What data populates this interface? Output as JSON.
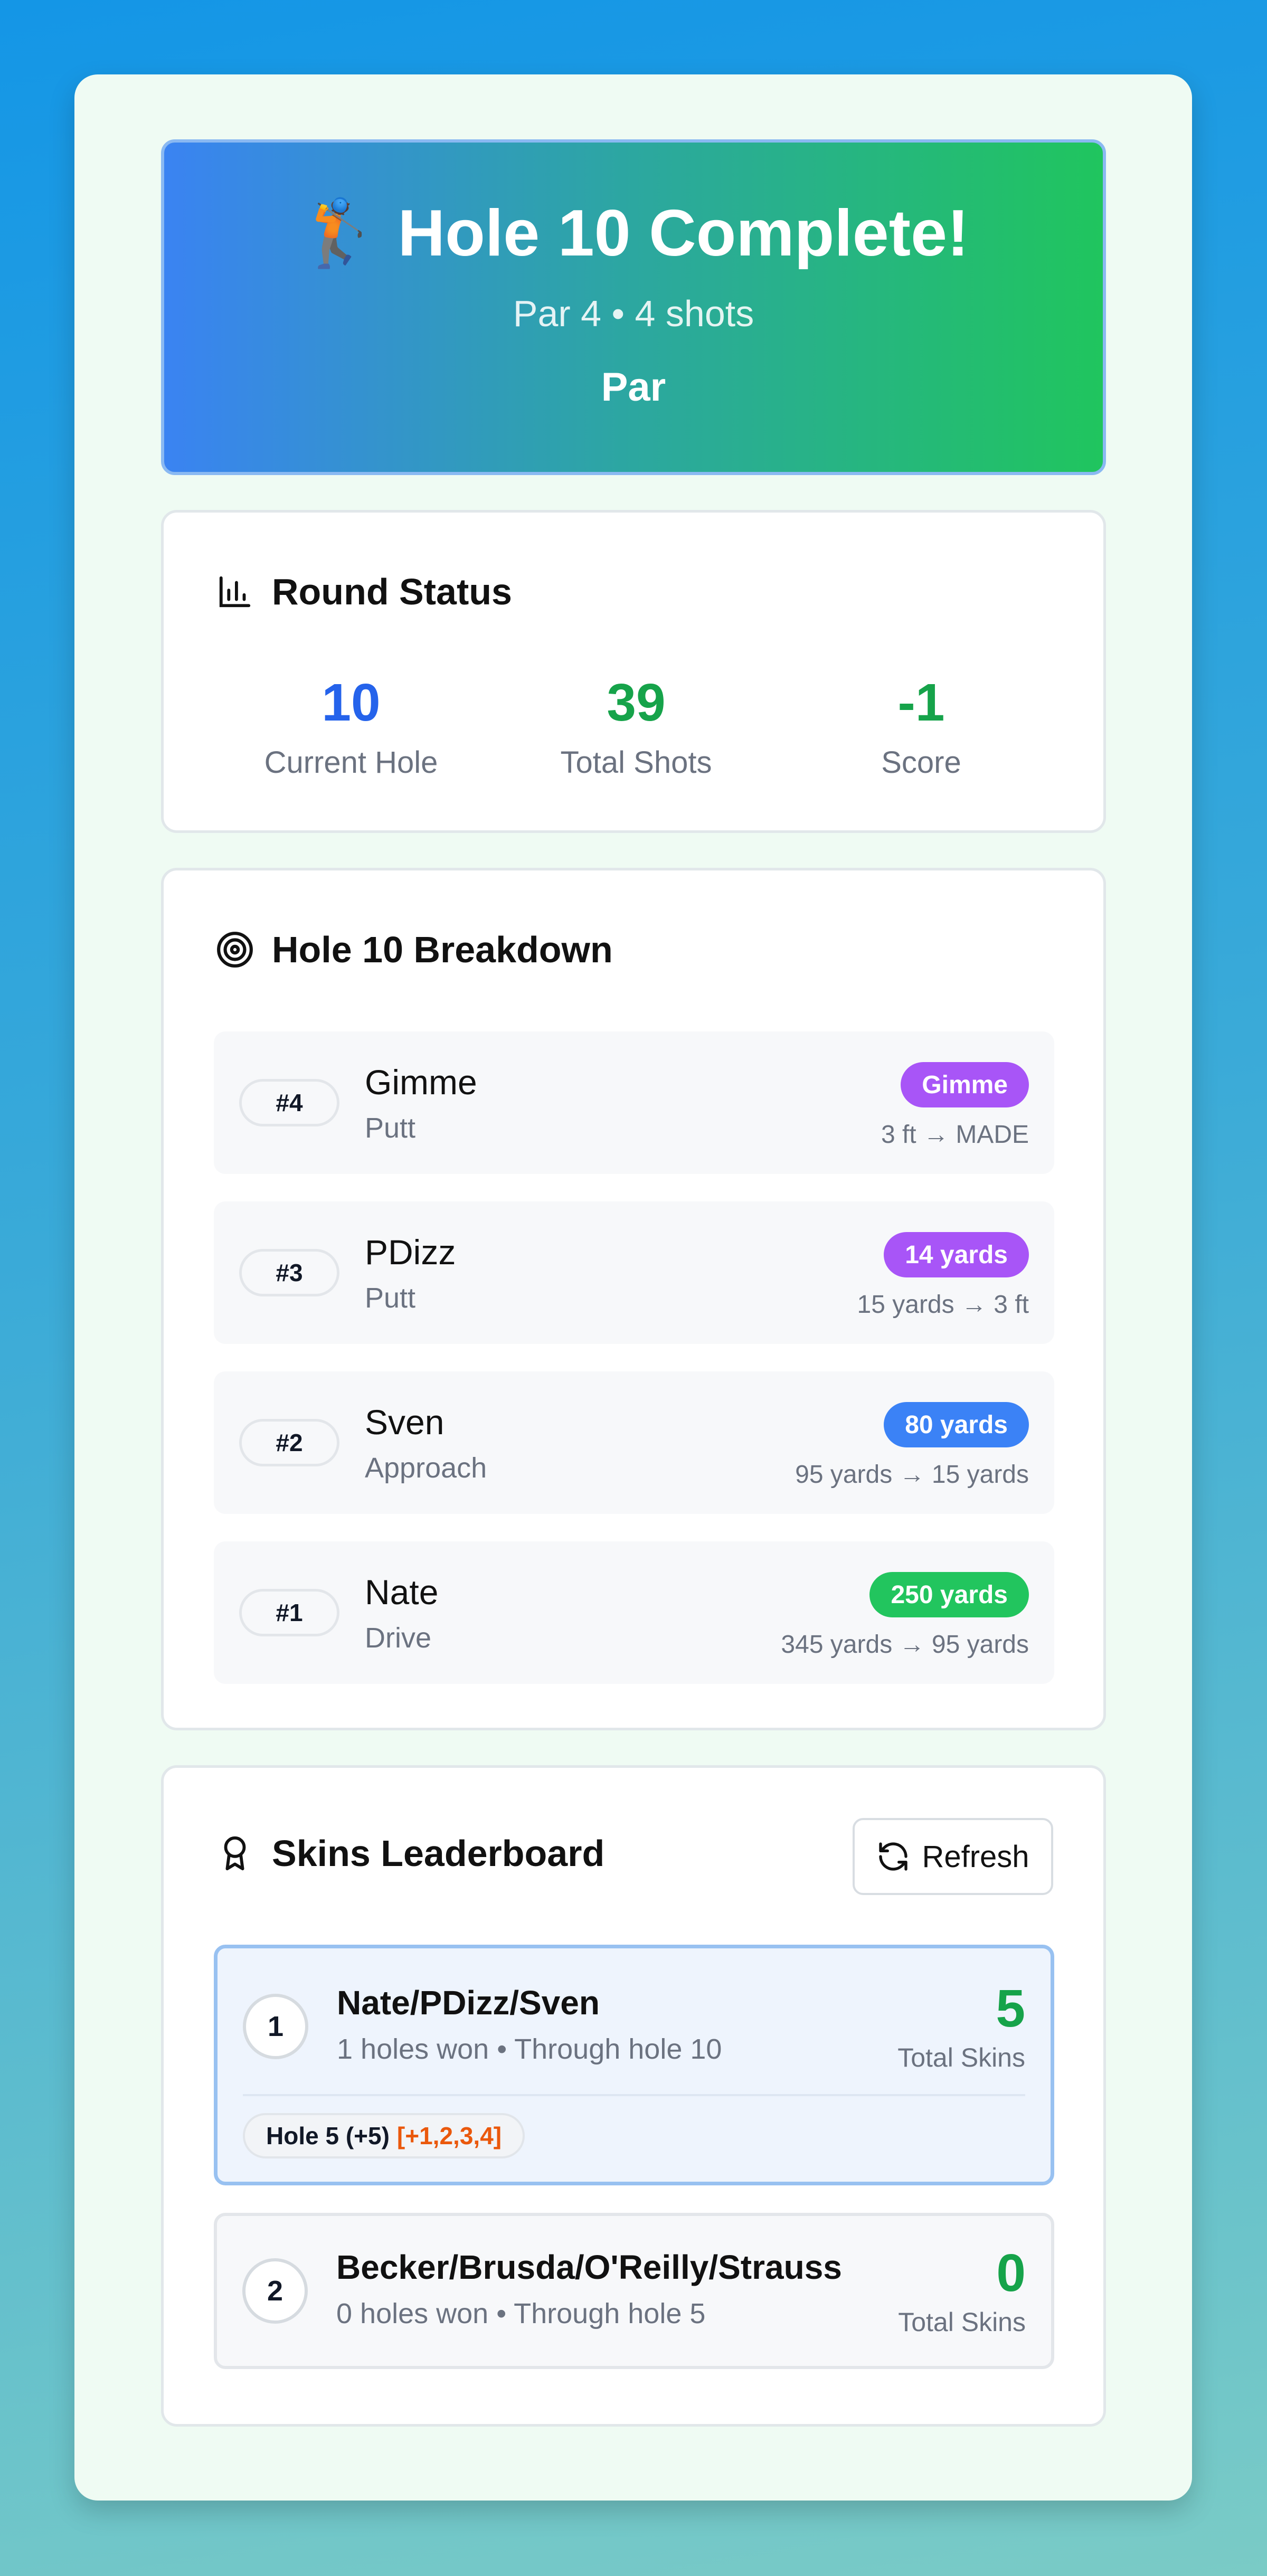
{
  "header": {
    "emoji": "🏌",
    "title": "Hole 10 Complete!",
    "subtitle": "Par 4 • 4 shots",
    "result": "Par"
  },
  "round_status": {
    "title": "Round Status",
    "stats": [
      {
        "value": "10",
        "label": "Current Hole",
        "color": "#2563eb"
      },
      {
        "value": "39",
        "label": "Total Shots",
        "color": "#16a34a"
      },
      {
        "value": "-1",
        "label": "Score",
        "color": "#16a34a"
      }
    ]
  },
  "breakdown": {
    "title": "Hole 10 Breakdown",
    "shots": [
      {
        "num": "#4",
        "player": "Gimme",
        "type": "Putt",
        "badge": "Gimme",
        "badge_color": "#a855f7",
        "detail": "3 ft → MADE"
      },
      {
        "num": "#3",
        "player": "PDizz",
        "type": "Putt",
        "badge": "14 yards",
        "badge_color": "#a855f7",
        "detail": "15 yards → 3 ft"
      },
      {
        "num": "#2",
        "player": "Sven",
        "type": "Approach",
        "badge": "80 yards",
        "badge_color": "#3b82f6",
        "detail": "95 yards → 15 yards"
      },
      {
        "num": "#1",
        "player": "Nate",
        "type": "Drive",
        "badge": "250 yards",
        "badge_color": "#22c55e",
        "detail": "345 yards → 95 yards"
      }
    ]
  },
  "leaderboard": {
    "title": "Skins Leaderboard",
    "refresh_label": "Refresh",
    "teams": [
      {
        "rank": "1",
        "name": "Nate/PDizz/Sven",
        "summary": "1 holes won • Through hole 10",
        "skins": "5",
        "skins_label": "Total Skins",
        "holes": [
          {
            "label": "Hole 5 (+5)",
            "carry": "[+1,2,3,4]"
          }
        ]
      },
      {
        "rank": "2",
        "name": "Becker/Brusda/O'Reilly/Strauss",
        "summary": "0 holes won • Through hole 5",
        "skins": "0",
        "skins_label": "Total Skins"
      }
    ]
  }
}
